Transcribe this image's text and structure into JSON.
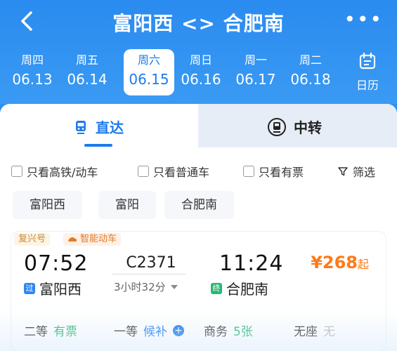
{
  "header": {
    "title": "富阳西 <> 合肥南",
    "more_label": "•••"
  },
  "dates": [
    {
      "weekday": "周四",
      "date": "06.13",
      "selected": false
    },
    {
      "weekday": "周五",
      "date": "06.14",
      "selected": false
    },
    {
      "weekday": "周六",
      "date": "06.15",
      "selected": true
    },
    {
      "weekday": "周日",
      "date": "06.16",
      "selected": false
    },
    {
      "weekday": "周一",
      "date": "06.17",
      "selected": false
    },
    {
      "weekday": "周二",
      "date": "06.18",
      "selected": false
    }
  ],
  "calendar": {
    "label": "日历"
  },
  "tabs": {
    "direct": "直达",
    "transfer": "中转"
  },
  "filters": [
    {
      "label": "只看高铁/动车"
    },
    {
      "label": "只看普通车"
    },
    {
      "label": "只看有票"
    },
    {
      "label": "筛选"
    }
  ],
  "stations": [
    "富阳西",
    "富阳",
    "合肥南"
  ],
  "train_card": {
    "badge1": "复兴号",
    "badge2": "智能动车",
    "depart_time": "07:52",
    "arrive_time": "11:24",
    "train_no": "C2371",
    "duration": "3小时32分",
    "from_tag": "过",
    "to_tag": "终",
    "from_station": "富阳西",
    "to_station": "合肥南",
    "price": "¥268",
    "price_suffix": "起",
    "seats": [
      {
        "type": "二等",
        "status": "有票"
      },
      {
        "type": "一等",
        "status": "候补"
      },
      {
        "type": "商务",
        "status": "5张"
      },
      {
        "type": "无座",
        "status": "无"
      }
    ]
  },
  "colors": {
    "brand_blue": "#1d7bec",
    "header_blue": "#2a8bf0",
    "price_orange": "#ff7a1a",
    "available_green": "#2bb673"
  }
}
